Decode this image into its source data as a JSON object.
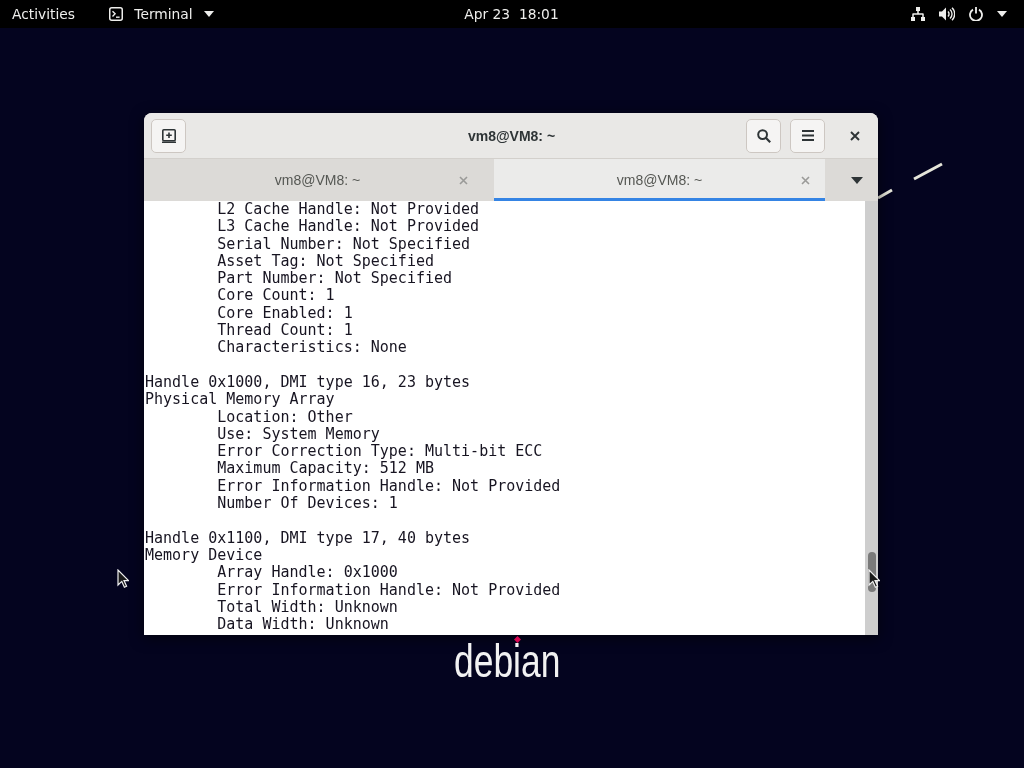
{
  "top_bar": {
    "activities": "Activities",
    "app_menu": "Terminal",
    "clock": "Apr 23  18:01"
  },
  "window": {
    "title": "vm8@VM8: ~",
    "tabs": [
      {
        "label": "vm8@VM8: ~",
        "selected": false
      },
      {
        "label": "vm8@VM8: ~",
        "selected": true
      }
    ],
    "terminal": {
      "records": [
        {
          "fields": [
            "L2 Cache Handle: Not Provided",
            "L3 Cache Handle: Not Provided",
            "Serial Number: Not Specified",
            "Asset Tag: Not Specified",
            "Part Number: Not Specified",
            "Core Count: 1",
            "Core Enabled: 1",
            "Thread Count: 1",
            "Characteristics: None"
          ]
        },
        {
          "handle": "Handle 0x1000, DMI type 16, 23 bytes",
          "title": "Physical Memory Array",
          "fields": [
            "Location: Other",
            "Use: System Memory",
            "Error Correction Type: Multi-bit ECC",
            "Maximum Capacity: 512 MB",
            "Error Information Handle: Not Provided",
            "Number Of Devices: 1"
          ]
        },
        {
          "handle": "Handle 0x1100, DMI type 17, 40 bytes",
          "title": "Memory Device",
          "fields": [
            "Array Handle: 0x1000",
            "Error Information Handle: Not Provided",
            "Total Width: Unknown",
            "Data Width: Unknown"
          ]
        }
      ]
    }
  },
  "desktop": {
    "logo": "debian"
  }
}
